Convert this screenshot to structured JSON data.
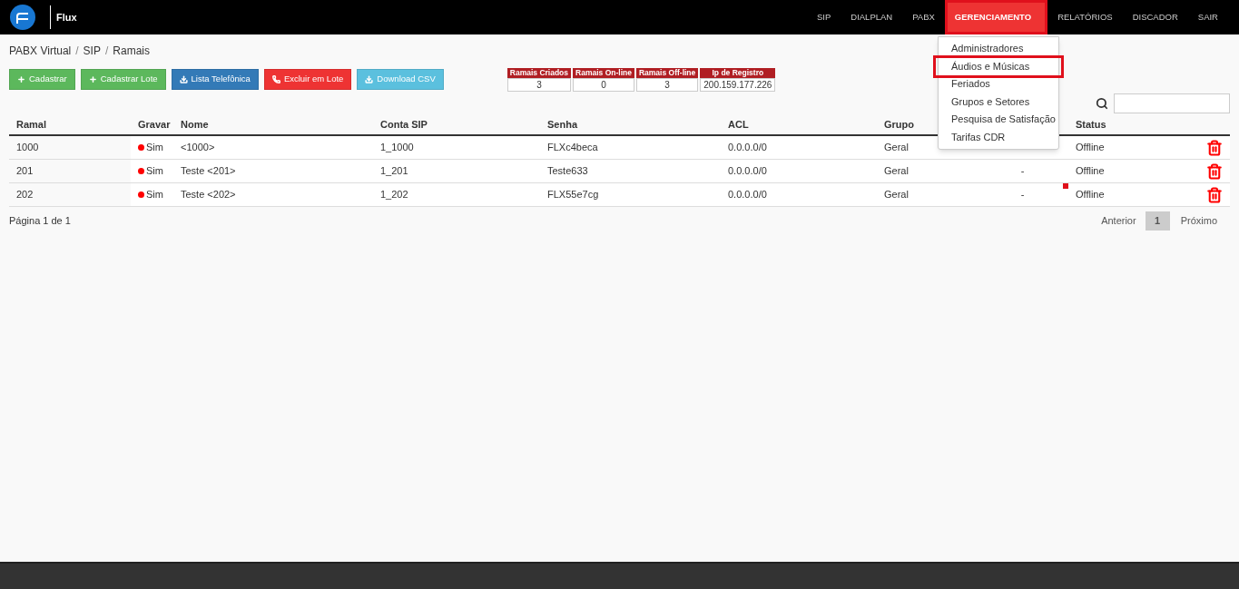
{
  "brand": {
    "name": "Flux"
  },
  "nav": [
    {
      "label": "SIP",
      "selected": false,
      "highlighted": false
    },
    {
      "label": "DIALPLAN",
      "selected": false,
      "highlighted": false
    },
    {
      "label": "PABX",
      "selected": false,
      "highlighted": false
    },
    {
      "label": "GERENCIAMENTO",
      "selected": true,
      "highlighted": true
    },
    {
      "label": "RELATÓRIOS",
      "selected": false,
      "highlighted": false
    },
    {
      "label": "DISCADOR",
      "selected": false,
      "highlighted": false
    },
    {
      "label": "SAIR",
      "selected": false,
      "highlighted": false
    }
  ],
  "dropdown": [
    {
      "label": "Administradores",
      "highlighted": false
    },
    {
      "label": "Áudios e Músicas",
      "highlighted": true
    },
    {
      "label": "Feriados",
      "highlighted": false
    },
    {
      "label": "Grupos e Setores",
      "highlighted": false
    },
    {
      "label": "Pesquisa de Satisfação",
      "highlighted": false
    },
    {
      "label": "Tarifas CDR",
      "highlighted": false
    }
  ],
  "breadcrumb": {
    "separator": "/",
    "items": [
      "PABX Virtual",
      "SIP",
      "Ramais"
    ]
  },
  "actions": [
    {
      "label": "Cadastrar",
      "kind": "add"
    },
    {
      "label": "Cadastrar Lote",
      "kind": "add"
    },
    {
      "label": "Lista Telefônica",
      "kind": "list"
    },
    {
      "label": "Excluir em Lote",
      "kind": "delete"
    },
    {
      "label": "Download CSV",
      "kind": "download"
    }
  ],
  "stats": [
    {
      "label": "Ramais Criados",
      "value": "3"
    },
    {
      "label": "Ramais On-line",
      "value": "0"
    },
    {
      "label": "Ramais Off-line",
      "value": "3"
    },
    {
      "label": "Ip de Registro",
      "value": "200.159.177.226"
    }
  ],
  "table": {
    "columns": [
      {
        "label": "Ramal"
      },
      {
        "label": "Gravar"
      },
      {
        "label": "Nome"
      },
      {
        "label": "Conta SIP"
      },
      {
        "label": "Senha"
      },
      {
        "label": "ACL"
      },
      {
        "label": "Grupo"
      },
      {},
      {
        "label": "Status"
      }
    ],
    "rows": [
      {
        "ramal": "1000",
        "gravar": "Sim",
        "nome": "<1000>",
        "conta_sip": "1_1000",
        "senha": "FLXc4beca",
        "acl": "0.0.0.0/0",
        "grupo": "Geral",
        "status": "Offline"
      },
      {
        "ramal": "201",
        "gravar": "Sim",
        "nome": "Teste <201>",
        "conta_sip": "1_201",
        "senha": "Teste633",
        "acl": "0.0.0.0/0",
        "grupo": "Geral",
        "column_8": "-",
        "status": "Offline"
      },
      {
        "ramal": "202",
        "gravar": "Sim",
        "nome": "Teste <202>",
        "conta_sip": "1_202",
        "senha": "FLX55e7cg",
        "acl": "0.0.0.0/0",
        "grupo": "Geral",
        "column_8": "-",
        "status": "Offline",
        "marked": true
      }
    ]
  },
  "pagination": {
    "info": "Página 1 de 1",
    "previous": "Anterior",
    "pages": [
      {
        "label": "1",
        "selected": true
      }
    ],
    "next": "Próximo"
  }
}
